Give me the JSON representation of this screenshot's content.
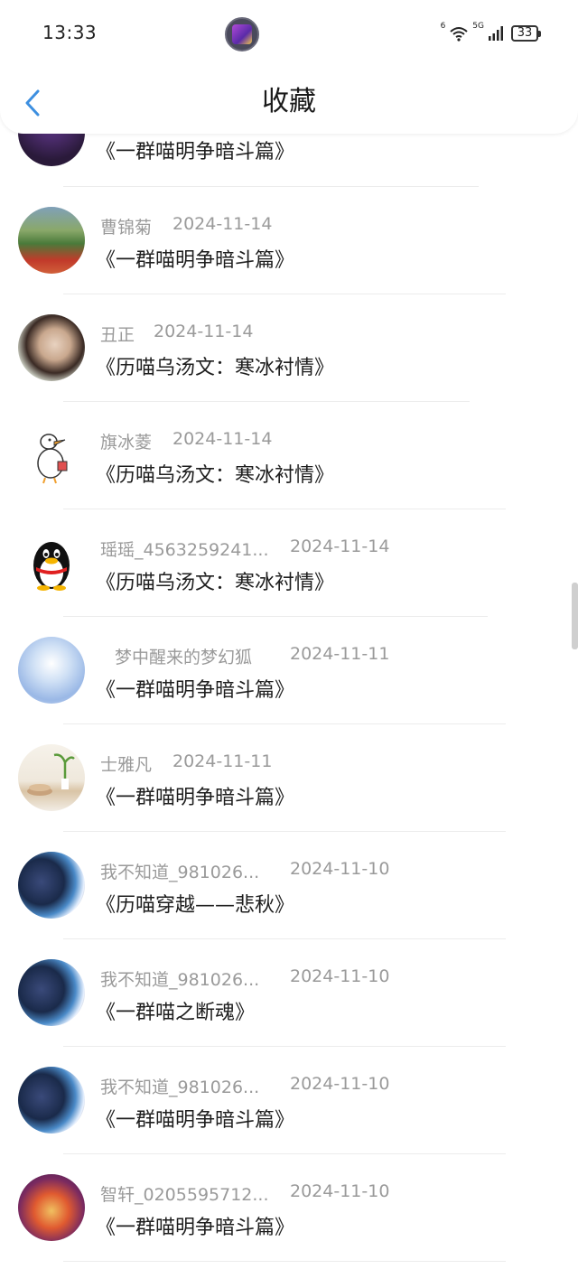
{
  "status_bar": {
    "time": "13:33",
    "network_small": "6",
    "network_type": "5G",
    "battery": "33"
  },
  "header": {
    "title": "收藏"
  },
  "colors": {
    "accent": "#3d8fe0",
    "meta": "#9a9a9a",
    "title": "#1e1e1e"
  },
  "favorites": [
    {
      "name": "",
      "date": "",
      "title": "《一群喵明争暗斗篇》",
      "avatar": "dark-purple-avatar"
    },
    {
      "name": "曹锦菊",
      "date": "2024-11-14",
      "title": "《一群喵明争暗斗篇》",
      "avatar": "garden-avatar"
    },
    {
      "name": "丑正",
      "date": "2024-11-14",
      "title": "《历喵乌汤文：寒冰衬情》",
      "avatar": "woman-portrait-avatar"
    },
    {
      "name": "旗冰菱",
      "date": "2024-11-14",
      "title": "《历喵乌汤文：寒冰衬情》",
      "avatar": "cartoon-goose-avatar"
    },
    {
      "name": "瑶瑶_4563259241...",
      "date": "2024-11-14",
      "title": "《历喵乌汤文：寒冰衬情》",
      "avatar": "penguin-avatar"
    },
    {
      "name": "梦中醒来的梦幻狐",
      "date": "2024-11-11",
      "title": "《一群喵明争暗斗篇》",
      "avatar": "anime-girl-avatar"
    },
    {
      "name": "士雅凡",
      "date": "2024-11-11",
      "title": "《一群喵明争暗斗篇》",
      "avatar": "plant-bowl-avatar"
    },
    {
      "name": "我不知道_981026...",
      "date": "2024-11-10",
      "title": "《历喵穿越——悲秋》",
      "avatar": "anime-cat-avatar"
    },
    {
      "name": "我不知道_981026...",
      "date": "2024-11-10",
      "title": "《一群喵之断魂》",
      "avatar": "anime-cat-avatar"
    },
    {
      "name": "我不知道_981026...",
      "date": "2024-11-10",
      "title": "《一群喵明争暗斗篇》",
      "avatar": "anime-cat-avatar"
    },
    {
      "name": "智轩_0205595712...",
      "date": "2024-11-10",
      "title": "《一群喵明争暗斗篇》",
      "avatar": "cartoon-red-avatar"
    }
  ]
}
